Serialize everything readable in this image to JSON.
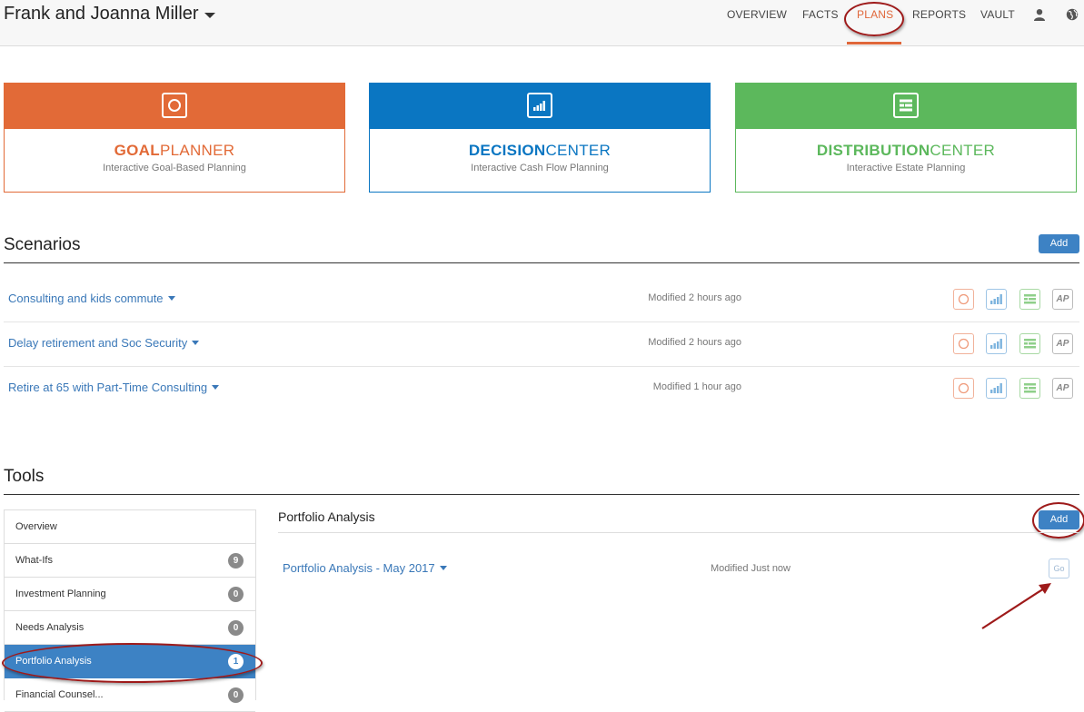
{
  "header": {
    "client_name": "Frank and Joanna Miller",
    "nav": [
      {
        "label": "OVERVIEW",
        "active": false
      },
      {
        "label": "FACTS",
        "active": false
      },
      {
        "label": "PLANS",
        "active": true
      },
      {
        "label": "REPORTS",
        "active": false
      },
      {
        "label": "VAULT",
        "active": false
      }
    ],
    "icons": [
      "user-icon",
      "globe-icon"
    ]
  },
  "products": [
    {
      "title_bold": "GOAL",
      "title_rest": "PLANNER",
      "subtitle": "Interactive Goal-Based Planning",
      "color": "#e26a37",
      "icon": "goal-planner-icon"
    },
    {
      "title_bold": "DECISION",
      "title_rest": "CENTER",
      "subtitle": "Interactive Cash Flow Planning",
      "color": "#0a76c2",
      "icon": "decision-center-icon"
    },
    {
      "title_bold": "DISTRIBUTION",
      "title_rest": "CENTER",
      "subtitle": "Interactive Estate Planning",
      "color": "#5cb85c",
      "icon": "distribution-center-icon"
    }
  ],
  "scenarios": {
    "title": "Scenarios",
    "add_label": "Add",
    "items": [
      {
        "name": "Consulting and kids commute",
        "modified": "Modified 2 hours ago"
      },
      {
        "name": "Delay retirement and Soc Security",
        "modified": "Modified 2 hours ago"
      },
      {
        "name": "Retire at 65 with Part-Time Consulting",
        "modified": "Modified 1 hour ago"
      }
    ],
    "ap_label": "AP"
  },
  "tools": {
    "title": "Tools",
    "nav": [
      {
        "label": "Overview",
        "count": null
      },
      {
        "label": "What-Ifs",
        "count": "9"
      },
      {
        "label": "Investment Planning",
        "count": "0"
      },
      {
        "label": "Needs Analysis",
        "count": "0"
      },
      {
        "label": "Portfolio Analysis",
        "count": "1",
        "active": true
      },
      {
        "label": "Financial Counsel...",
        "count": "0"
      }
    ],
    "panel": {
      "title": "Portfolio Analysis",
      "add_label": "Add",
      "item_name": "Portfolio Analysis - May 2017",
      "item_modified": "Modified Just now",
      "go_label": "Go"
    }
  },
  "colors": {
    "accent": "#e0673a",
    "primary_button": "#3d82c4",
    "link": "#3a78b8",
    "annotation": "#9e1a1a"
  }
}
